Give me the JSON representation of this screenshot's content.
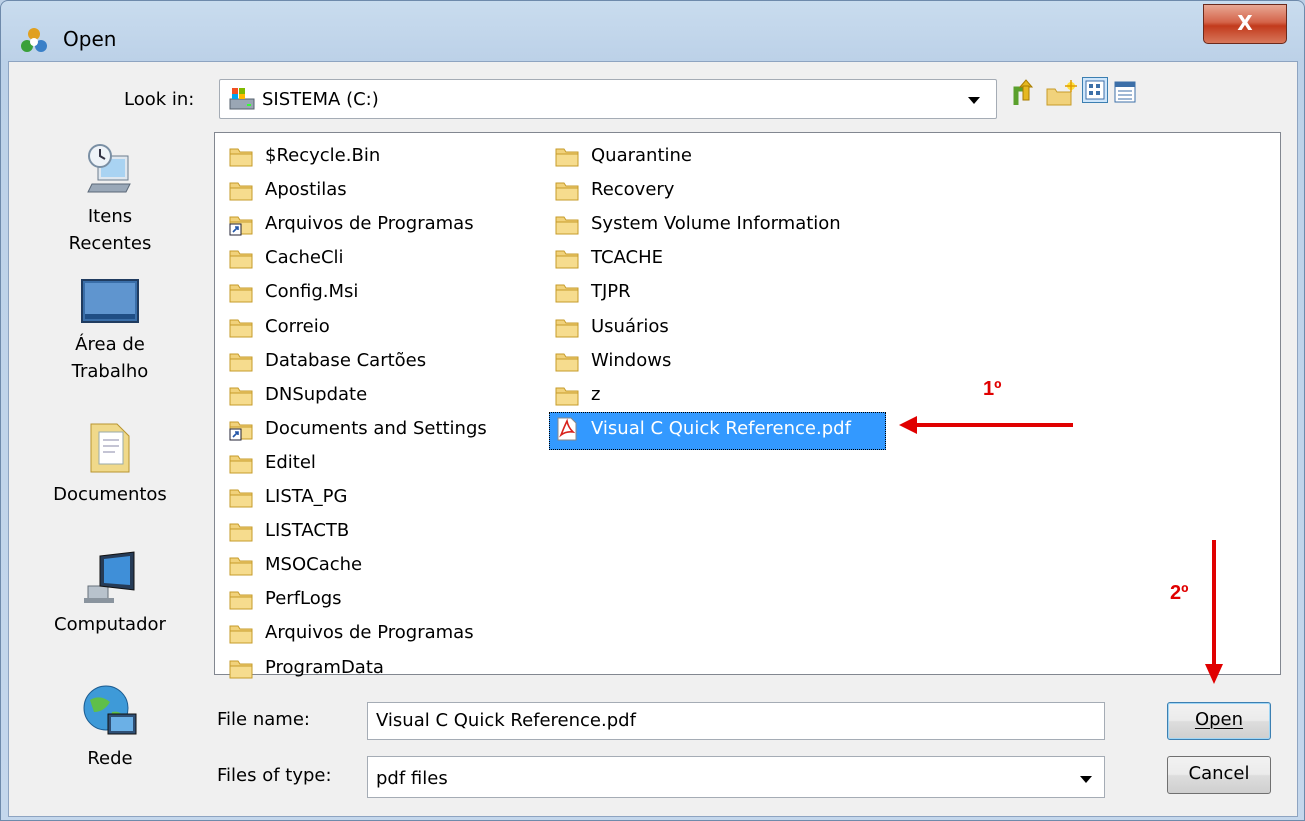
{
  "window": {
    "title": "Open",
    "close_glyph": "X"
  },
  "lookin": {
    "label": "Look in:",
    "value": "SISTEMA (C:)"
  },
  "toolbar": {
    "icons": [
      "up-folder-icon",
      "new-folder-icon",
      "view-list-icon",
      "view-details-icon"
    ]
  },
  "places": [
    {
      "label_lines": [
        "Itens",
        "Recentes"
      ],
      "icon": "recent-items-icon"
    },
    {
      "label_lines": [
        "Área de",
        "Trabalho"
      ],
      "icon": "desktop-icon"
    },
    {
      "label_lines": [
        "Documentos"
      ],
      "icon": "documents-icon"
    },
    {
      "label_lines": [
        "Computador"
      ],
      "icon": "computer-icon"
    },
    {
      "label_lines": [
        "Rede"
      ],
      "icon": "network-icon"
    }
  ],
  "files": {
    "column1": [
      {
        "name": "$Recycle.Bin",
        "type": "folder"
      },
      {
        "name": "Apostilas",
        "type": "folder"
      },
      {
        "name": "Arquivos de Programas",
        "type": "shortcut-folder"
      },
      {
        "name": "CacheCli",
        "type": "folder"
      },
      {
        "name": "Config.Msi",
        "type": "folder"
      },
      {
        "name": "Correio",
        "type": "folder"
      },
      {
        "name": "Database Cartões",
        "type": "folder"
      },
      {
        "name": "DNSupdate",
        "type": "folder"
      },
      {
        "name": "Documents and Settings",
        "type": "shortcut-folder"
      },
      {
        "name": "Editel",
        "type": "folder"
      },
      {
        "name": "LISTA_PG",
        "type": "folder"
      },
      {
        "name": "LISTACTB",
        "type": "folder"
      },
      {
        "name": "MSOCache",
        "type": "folder"
      },
      {
        "name": "PerfLogs",
        "type": "folder"
      },
      {
        "name": "Arquivos de Programas",
        "type": "folder"
      },
      {
        "name": "ProgramData",
        "type": "folder"
      }
    ],
    "column2": [
      {
        "name": "Quarantine",
        "type": "folder"
      },
      {
        "name": "Recovery",
        "type": "folder"
      },
      {
        "name": "System Volume Information",
        "type": "folder"
      },
      {
        "name": "TCACHE",
        "type": "folder"
      },
      {
        "name": "TJPR",
        "type": "folder"
      },
      {
        "name": "Usuários",
        "type": "folder"
      },
      {
        "name": "Windows",
        "type": "folder"
      },
      {
        "name": "z",
        "type": "folder"
      },
      {
        "name": "Visual C Quick Reference.pdf",
        "type": "pdf",
        "selected": true
      }
    ]
  },
  "filename": {
    "label": "File name:",
    "value": "Visual C Quick Reference.pdf"
  },
  "filetype": {
    "label": "Files of type:",
    "value": "pdf files"
  },
  "buttons": {
    "open": "Open",
    "cancel": "Cancel"
  },
  "annotations": {
    "step1": "1º",
    "step2": "2º",
    "color": "#e00000"
  }
}
